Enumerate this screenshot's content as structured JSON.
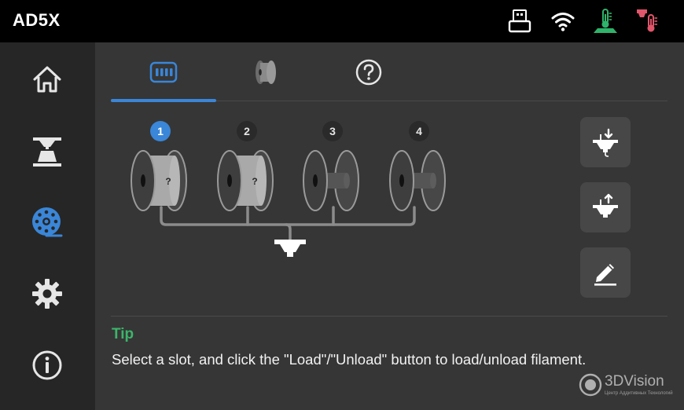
{
  "header": {
    "title": "AD5X",
    "status_icons": [
      "usb-icon",
      "wifi-icon",
      "bed-temperature-icon",
      "nozzle-temperature-icon"
    ]
  },
  "sidebar": {
    "items": [
      {
        "name": "home-icon",
        "active": false
      },
      {
        "name": "print-icon",
        "active": false
      },
      {
        "name": "filament-icon",
        "active": true
      },
      {
        "name": "settings-icon",
        "active": false
      },
      {
        "name": "info-icon",
        "active": false
      }
    ]
  },
  "tabs": [
    {
      "name": "ifs-slots-icon",
      "active": true
    },
    {
      "name": "external-spool-icon",
      "active": false
    },
    {
      "name": "help-icon",
      "active": false
    }
  ],
  "slots": [
    {
      "number": "1",
      "loaded": true,
      "label": "?",
      "selected": true
    },
    {
      "number": "2",
      "loaded": true,
      "label": "?",
      "selected": false
    },
    {
      "number": "3",
      "loaded": false,
      "label": "",
      "selected": false
    },
    {
      "number": "4",
      "loaded": false,
      "label": "",
      "selected": false
    }
  ],
  "actions": [
    {
      "name": "load-filament-icon"
    },
    {
      "name": "unload-filament-icon"
    },
    {
      "name": "edit-icon"
    }
  ],
  "tip": {
    "title": "Tip",
    "text": "Select a slot, and click the \"Load\"/\"Unload\" button to load/unload filament."
  },
  "watermark": {
    "brand": "3DVision",
    "subtitle": "Центр Аддитивных Технологий"
  },
  "colors": {
    "accent": "#3a86d8",
    "tip_green": "#3cb56b",
    "bed_icon_green": "#2fb36a",
    "nozzle_icon_red": "#e0566b"
  }
}
